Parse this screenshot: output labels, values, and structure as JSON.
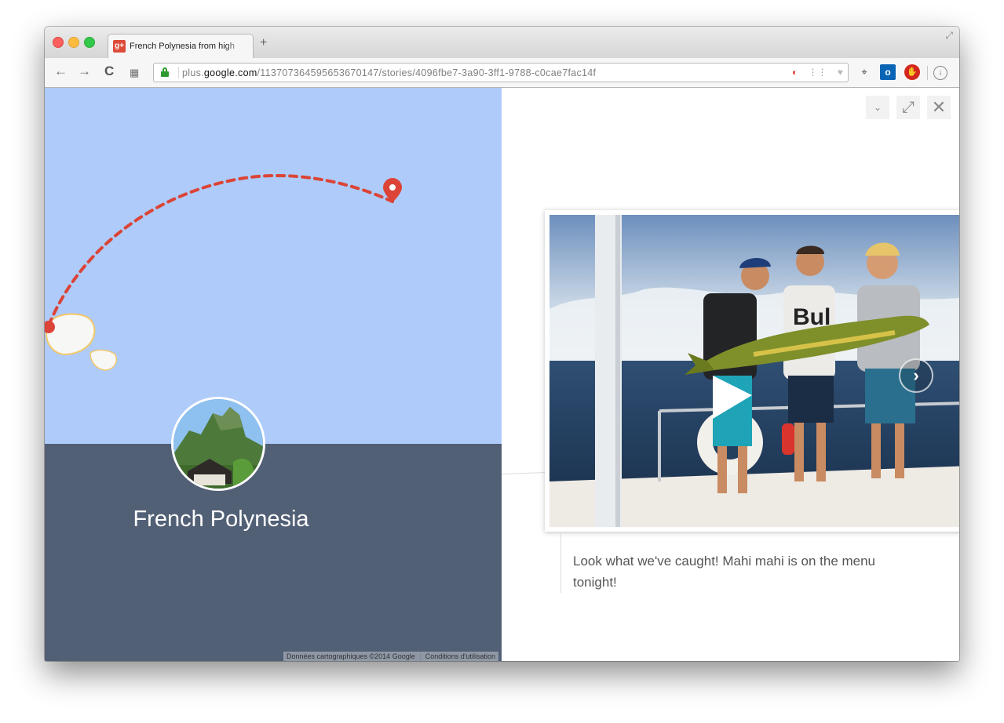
{
  "browser": {
    "tab_title": "French Polynesia from high",
    "new_tab_symbol": "+",
    "url_prefix": "plus.",
    "url_domain": "google.com",
    "url_path": "/113707364595653670147/stories/4096fbe7-3a90-3ff1-9788-c0cae7fac14f",
    "favicon_text": "g+"
  },
  "story": {
    "place_title": "French Polynesia",
    "caption": "Look what we've caught! Mahi mahi is on the menu tonight!",
    "map_attribution": "Données cartographiques ©2014 Google",
    "map_terms": "Conditions d'utilisation"
  },
  "colors": {
    "map_water": "#aecbfa",
    "panel": "#526076",
    "route": "#db4437"
  },
  "icons": {
    "back": "arrow-left",
    "forward": "arrow-right",
    "reload": "reload",
    "apps": "apps-grid",
    "lock": "lock",
    "collapse": "chevron-down",
    "expand": "expand-arrows",
    "close": "close-x",
    "next": "chevron-right",
    "pin": "map-pin"
  }
}
